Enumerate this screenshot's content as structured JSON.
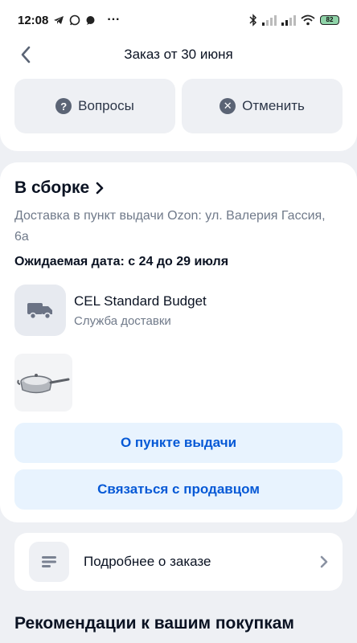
{
  "status_bar": {
    "time": "12:08",
    "dots": "···",
    "battery": "82",
    "icons": [
      "telegram-icon",
      "whatsapp-icon",
      "chat-icon",
      "bluetooth-icon",
      "signal-icon",
      "signal-icon",
      "wifi-icon",
      "battery-icon"
    ]
  },
  "header": {
    "title": "Заказ от 30 июня",
    "back_icon": "chevron-left-icon"
  },
  "actions": {
    "questions_label": "Вопросы",
    "questions_icon": "question-circle-icon",
    "cancel_label": "Отменить",
    "cancel_icon": "x-circle-icon"
  },
  "order": {
    "status_label": "В сборке",
    "address": "Доставка в пункт выдачи Ozon: ул. Валерия Гассия, 6а",
    "expected_date": "Ожидаемая дата: с 24 до 29 июля",
    "delivery_service_name": "CEL Standard Budget",
    "delivery_service_caption": "Служба доставки",
    "product_image": "frying-pan-image",
    "pickup_point_button": "О пункте выдачи",
    "contact_seller_button": "Связаться с продавцом"
  },
  "details": {
    "label": "Подробнее о заказе",
    "icon": "document-lines-icon"
  },
  "recommendations": {
    "title": "Рекомендации к вашим покупкам"
  },
  "colors": {
    "accent": "#0659d6",
    "button_bg": "#e8f3fe",
    "page_bg": "#eef0f4",
    "muted_text": "#707a8a"
  }
}
